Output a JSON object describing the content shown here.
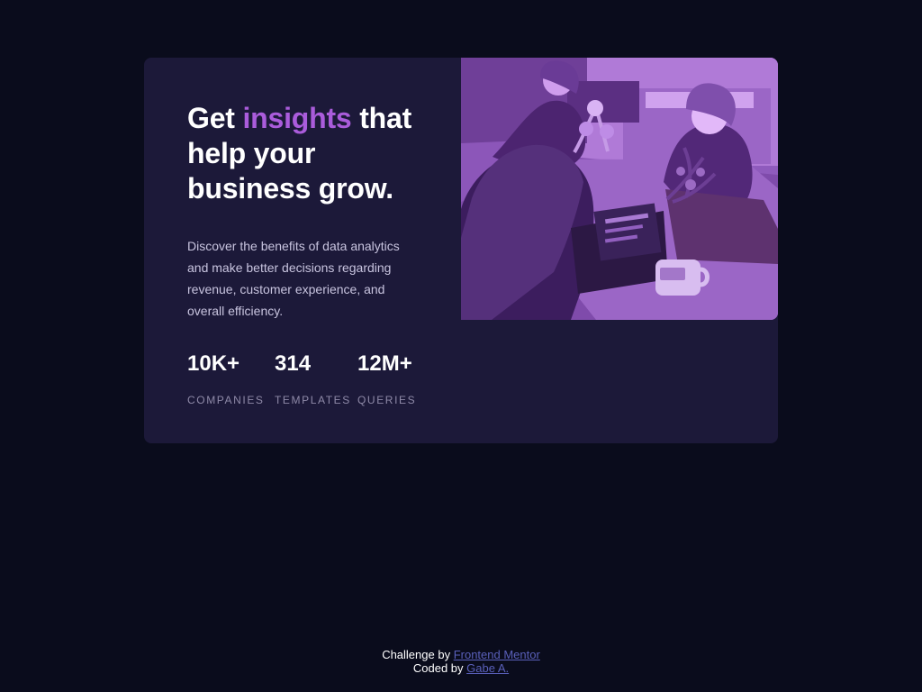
{
  "card": {
    "headline": {
      "part1": "Get ",
      "accent": "insights",
      "part2": " that help your business grow."
    },
    "description": "Discover the benefits of data analytics and make better decisions regarding revenue, customer experience, and overall efficiency.",
    "stats": [
      {
        "value": "10K+",
        "label": "COMPANIES"
      },
      {
        "value": "314",
        "label": "TEMPLATES"
      },
      {
        "value": "12M+",
        "label": "QUERIES"
      }
    ]
  },
  "footer": {
    "challenge_prefix": "Challenge by ",
    "challenge_link": "Frontend Mentor",
    "coded_prefix": "Coded by ",
    "coded_link": "Gabe A."
  },
  "colors": {
    "page_bg": "#0a0c1c",
    "card_bg": "#1c1939",
    "accent": "#aa5cdb",
    "image_tint": "#a36ccf",
    "link": "#5a60ba"
  },
  "icons": {
    "photo": "team-meeting-photo"
  }
}
